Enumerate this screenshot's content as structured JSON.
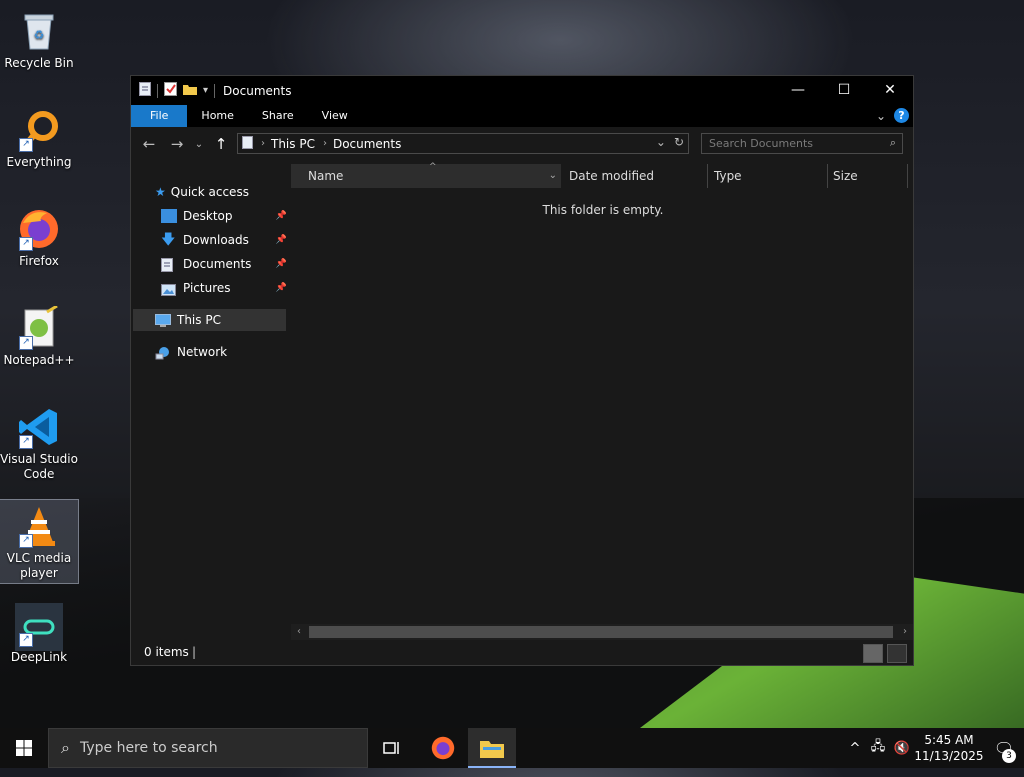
{
  "desktop": {
    "icons": [
      {
        "label": "Recycle Bin",
        "icon": "recycle-bin-icon"
      },
      {
        "label": "Everything",
        "icon": "everything-icon"
      },
      {
        "label": "Firefox",
        "icon": "firefox-icon"
      },
      {
        "label": "Notepad++",
        "icon": "notepadpp-icon"
      },
      {
        "label": "Visual Studio Code",
        "icon": "vscode-icon"
      },
      {
        "label": "VLC media player",
        "icon": "vlc-icon"
      },
      {
        "label": "DeepLink",
        "icon": "deeplink-icon"
      }
    ]
  },
  "window": {
    "title": "Documents",
    "ribbon_tabs": [
      "File",
      "Home",
      "Share",
      "View"
    ],
    "breadcrumb": [
      "This PC",
      "Documents"
    ],
    "search_placeholder": "Search Documents",
    "nav": {
      "quick_access": "Quick access",
      "pinned": [
        "Desktop",
        "Downloads",
        "Documents",
        "Pictures"
      ],
      "this_pc": "This PC",
      "network": "Network"
    },
    "columns": [
      "Name",
      "Date modified",
      "Type",
      "Size"
    ],
    "empty_message": "This folder is empty.",
    "status": "0 items"
  },
  "taskbar": {
    "search_placeholder": "Type here to search",
    "time": "5:45 AM",
    "date": "11/13/2025",
    "notification_count": "3"
  },
  "colors": {
    "accent": "#1979ca",
    "window_bg": "#191919",
    "titlebar": "#000000"
  }
}
